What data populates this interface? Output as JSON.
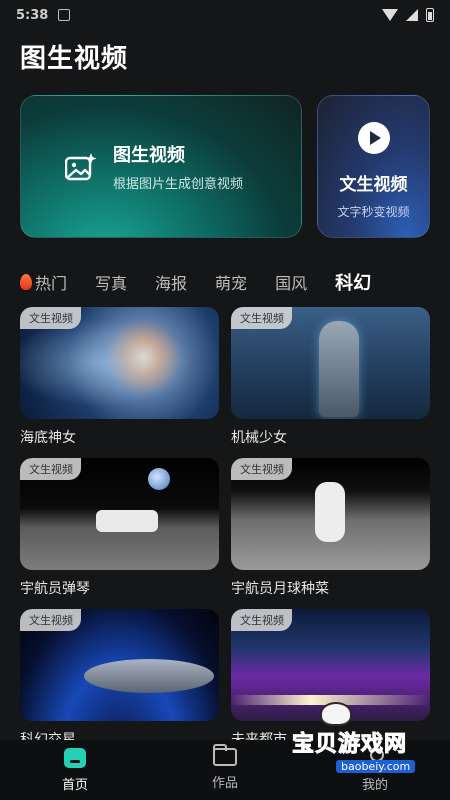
{
  "status_bar": {
    "time": "5:38"
  },
  "page": {
    "title": "图生视频"
  },
  "hero": {
    "main": {
      "title": "图生视频",
      "subtitle": "根据图片生成创意视频"
    },
    "side": {
      "title": "文生视频",
      "subtitle": "文字秒变视频"
    }
  },
  "tabs": [
    {
      "label": "热门",
      "icon": "fire-icon",
      "active": false
    },
    {
      "label": "写真",
      "active": false
    },
    {
      "label": "海报",
      "active": false
    },
    {
      "label": "萌宠",
      "active": false
    },
    {
      "label": "国风",
      "active": false
    },
    {
      "label": "科幻",
      "active": true
    }
  ],
  "cards": [
    {
      "badge": "文生视频",
      "title": "海底神女"
    },
    {
      "badge": "文生视频",
      "title": "机械少女"
    },
    {
      "badge": "文生视频",
      "title": "宇航员弹琴"
    },
    {
      "badge": "文生视频",
      "title": "宇航员月球种菜"
    },
    {
      "badge": "文生视频",
      "title": "科幻交星"
    },
    {
      "badge": "文生视频",
      "title": "未来都市"
    }
  ],
  "bottom_nav": [
    {
      "label": "首页",
      "icon": "home-icon",
      "active": true
    },
    {
      "label": "作品",
      "icon": "folder-icon",
      "active": false
    },
    {
      "label": "我的",
      "icon": "person-icon",
      "active": false
    }
  ],
  "watermark": {
    "title": "宝贝游戏网",
    "url": "baobeiy.com"
  },
  "colors": {
    "accent": "#25d0b6",
    "background": "#151617"
  }
}
